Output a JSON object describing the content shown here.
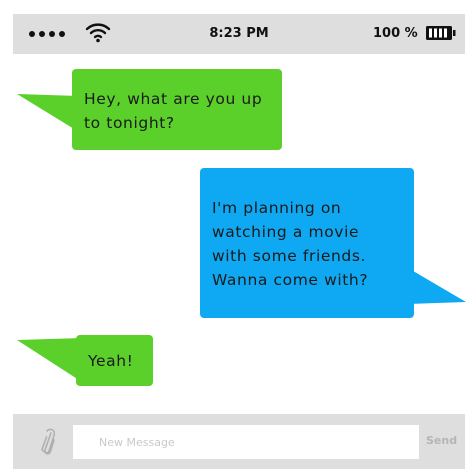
{
  "status_bar": {
    "time": "8:23 PM",
    "battery_percent": "100 %",
    "icons": [
      "signal-dots-icon",
      "wifi-icon",
      "battery-icon"
    ]
  },
  "messages": [
    {
      "sender": "other",
      "text": "Hey, what are you up\nto tonight?",
      "color": "#5bd02b"
    },
    {
      "sender": "me",
      "text": "I'm planning on\nwatching a movie\nwith some friends.\nWanna come with?",
      "color": "#0fa9f3"
    },
    {
      "sender": "other",
      "text": "Yeah!",
      "color": "#5bd02b"
    }
  ],
  "composer": {
    "attach_icon": "paperclip-icon",
    "placeholder": "New Message",
    "send_label": "Send"
  }
}
